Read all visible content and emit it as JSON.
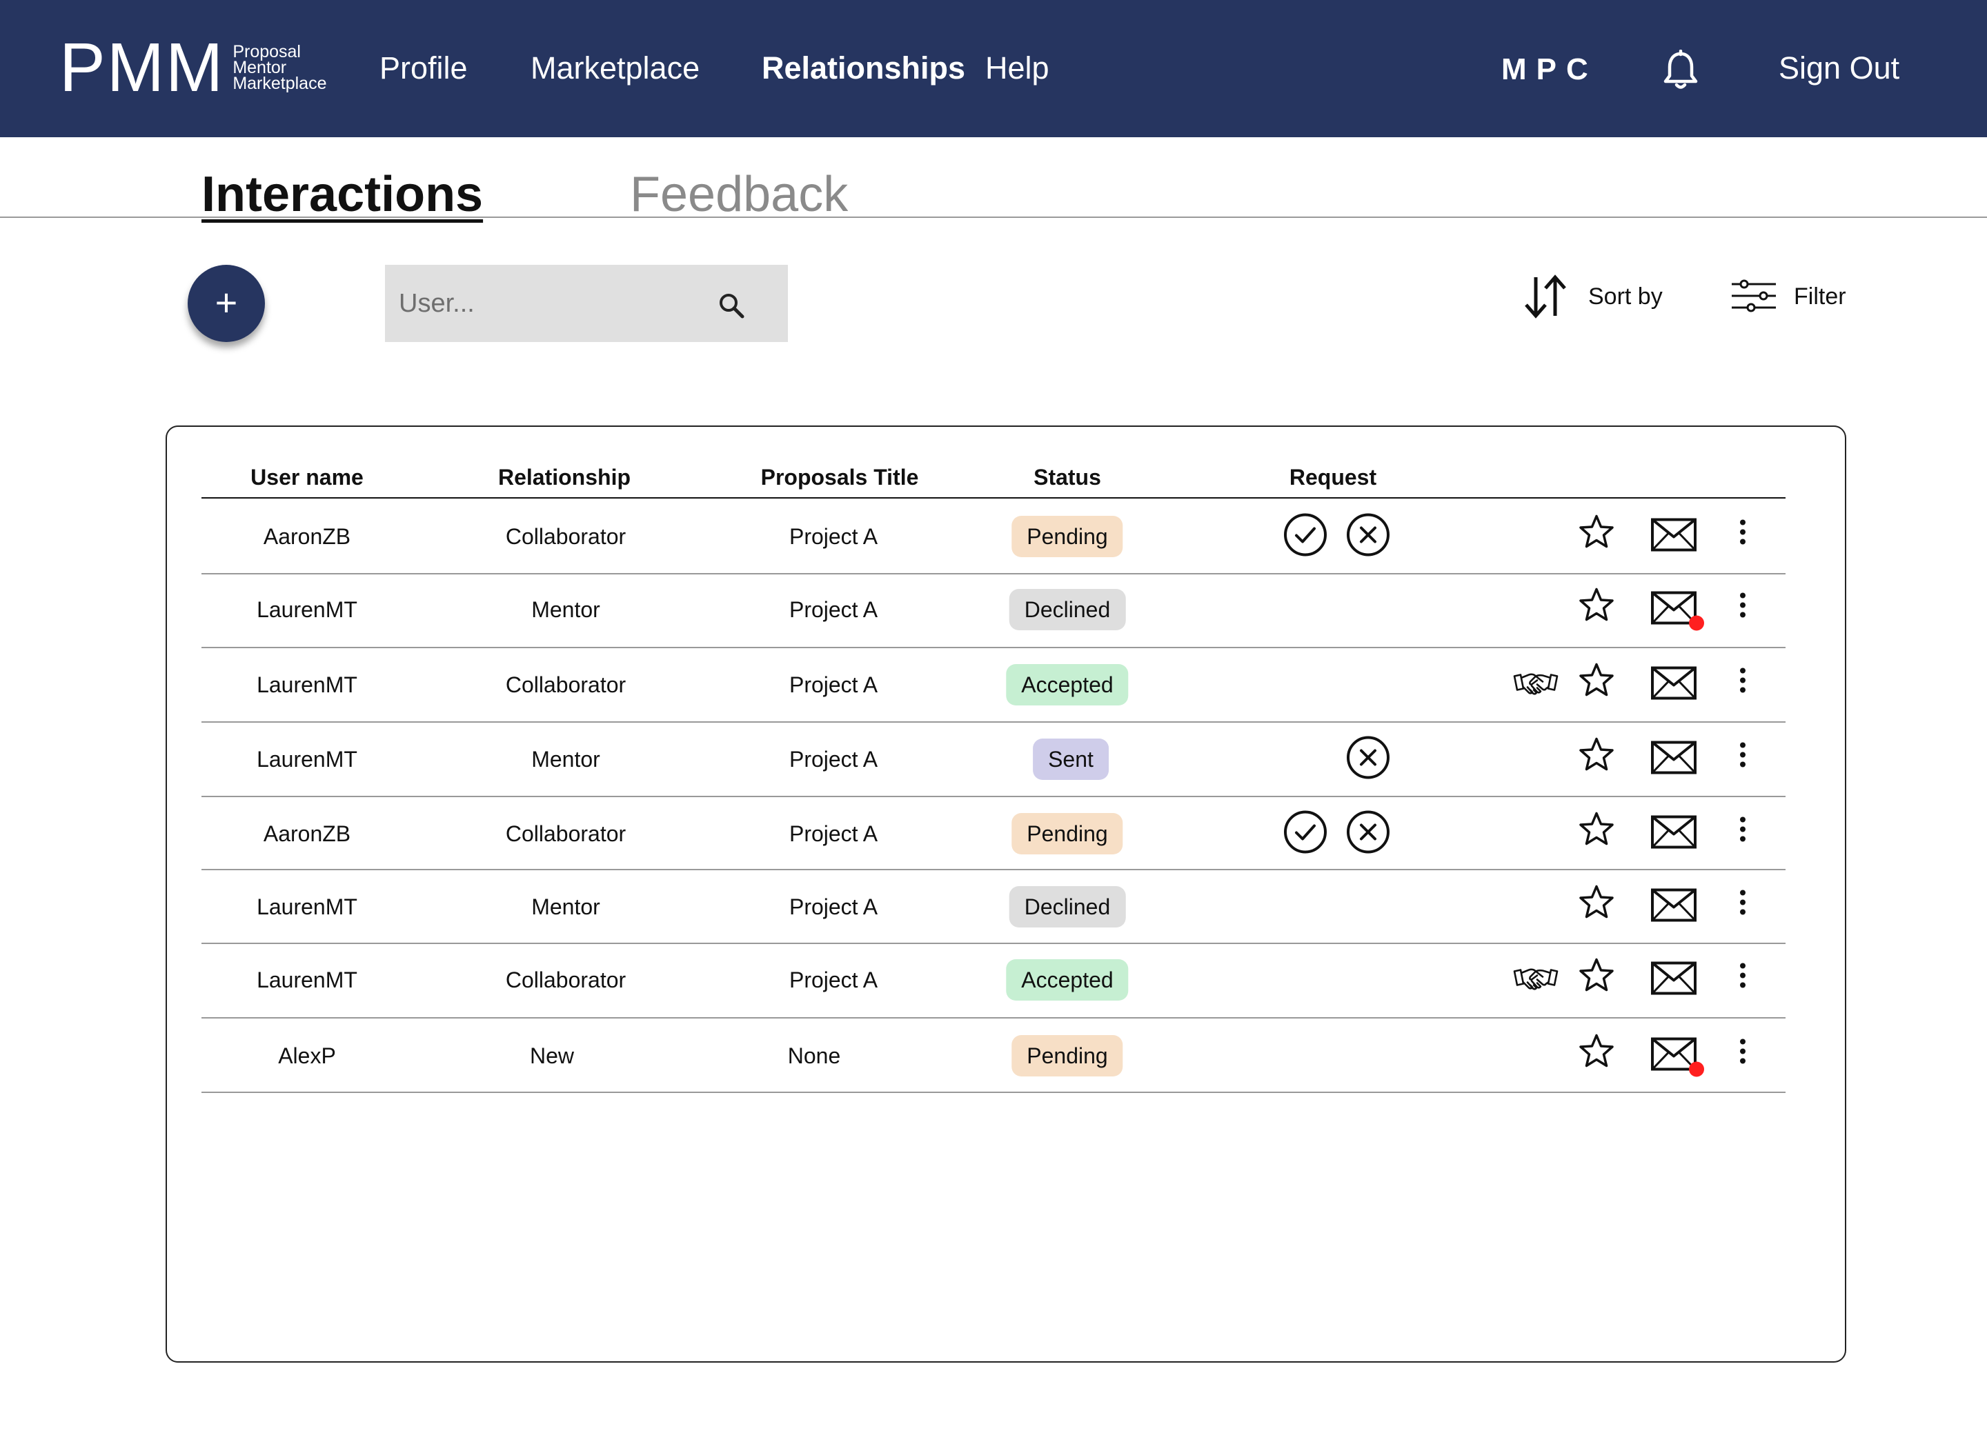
{
  "brand": {
    "mark": "PMM",
    "sub": [
      "Proposal",
      "Mentor",
      "Marketplace"
    ]
  },
  "nav": {
    "links": [
      {
        "label": "Profile",
        "active": false
      },
      {
        "label": "Marketplace",
        "active": false
      },
      {
        "label": "Relationships",
        "active": true
      },
      {
        "label": "Help",
        "active": false
      }
    ],
    "user_initials": "MPC",
    "notifications_icon": "bell-icon",
    "signout": "Sign Out"
  },
  "tabs": [
    {
      "label": "Interactions",
      "active": true
    },
    {
      "label": "Feedback",
      "active": false
    }
  ],
  "toolbar": {
    "add_label": "+",
    "search_placeholder": "User...",
    "sort_label": "Sort by",
    "filter_label": "Filter"
  },
  "table": {
    "columns": [
      "User name",
      "Relationship",
      "Proposals Title",
      "Status",
      "Request"
    ],
    "rows": [
      {
        "user": "AaronZB",
        "relationship": "Collaborator",
        "title": "Project A",
        "status": "Pending",
        "request": [
          "accept",
          "decline"
        ],
        "handshake": false,
        "unread": false
      },
      {
        "user": "LaurenMT",
        "relationship": "Mentor",
        "title": "Project A",
        "status": "Declined",
        "request": [],
        "handshake": false,
        "unread": true
      },
      {
        "user": "LaurenMT",
        "relationship": "Collaborator",
        "title": "Project A",
        "status": "Accepted",
        "request": [],
        "handshake": true,
        "unread": false
      },
      {
        "user": "LaurenMT",
        "relationship": "Mentor",
        "title": "Project A",
        "status": "Sent",
        "request": [
          "decline"
        ],
        "handshake": false,
        "unread": false
      },
      {
        "user": "AaronZB",
        "relationship": "Collaborator",
        "title": "Project A",
        "status": "Pending",
        "request": [
          "accept",
          "decline"
        ],
        "handshake": false,
        "unread": false
      },
      {
        "user": "LaurenMT",
        "relationship": "Mentor",
        "title": "Project A",
        "status": "Declined",
        "request": [],
        "handshake": false,
        "unread": false
      },
      {
        "user": "LaurenMT",
        "relationship": "Collaborator",
        "title": "Project A",
        "status": "Accepted",
        "request": [],
        "handshake": true,
        "unread": false
      },
      {
        "user": "AlexP",
        "relationship": "New",
        "title": "None",
        "status": "Pending",
        "request": [],
        "handshake": false,
        "unread": true
      }
    ]
  },
  "colors": {
    "navbar": "#263560",
    "status_pending": "#f7dfc6",
    "status_declined": "#dedede",
    "status_accepted": "#c6efd2",
    "status_sent": "#cfcdea",
    "unread_dot": "#ff1f1f"
  }
}
